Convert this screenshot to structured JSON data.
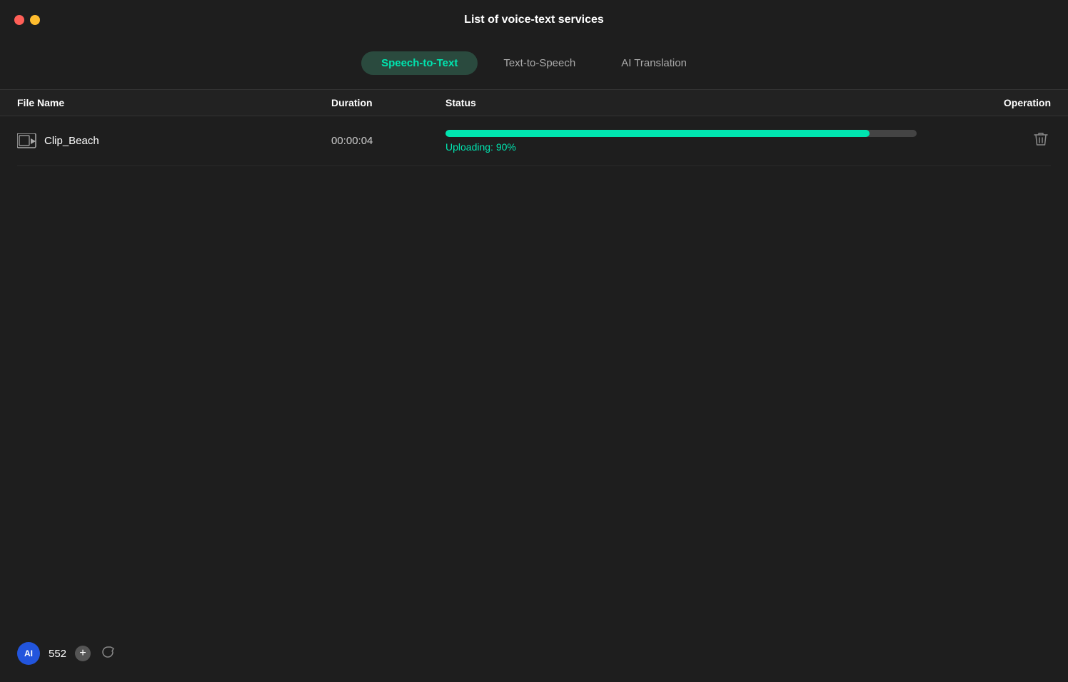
{
  "window": {
    "title": "List of voice-text services",
    "controls": {
      "close_color": "#ff5f57",
      "minimize_color": "#febc2e"
    }
  },
  "tabs": [
    {
      "id": "speech-to-text",
      "label": "Speech-to-Text",
      "active": true
    },
    {
      "id": "text-to-speech",
      "label": "Text-to-Speech",
      "active": false
    },
    {
      "id": "ai-translation",
      "label": "AI Translation",
      "active": false
    }
  ],
  "table": {
    "headers": {
      "filename": "File Name",
      "duration": "Duration",
      "status": "Status",
      "operation": "Operation"
    },
    "rows": [
      {
        "filename": "Clip_Beach",
        "duration": "00:00:04",
        "status_text": "Uploading:  90%",
        "progress": 90,
        "id": "row-1"
      }
    ]
  },
  "bottom_bar": {
    "ai_label": "AI",
    "credit_count": "552",
    "add_label": "+",
    "refresh_label": "↻"
  },
  "colors": {
    "accent": "#00e5b0",
    "progress_track": "#444444",
    "active_tab_bg": "#2a4a3e",
    "active_tab_text": "#00e5b0",
    "ai_badge_bg": "#2255dd"
  }
}
